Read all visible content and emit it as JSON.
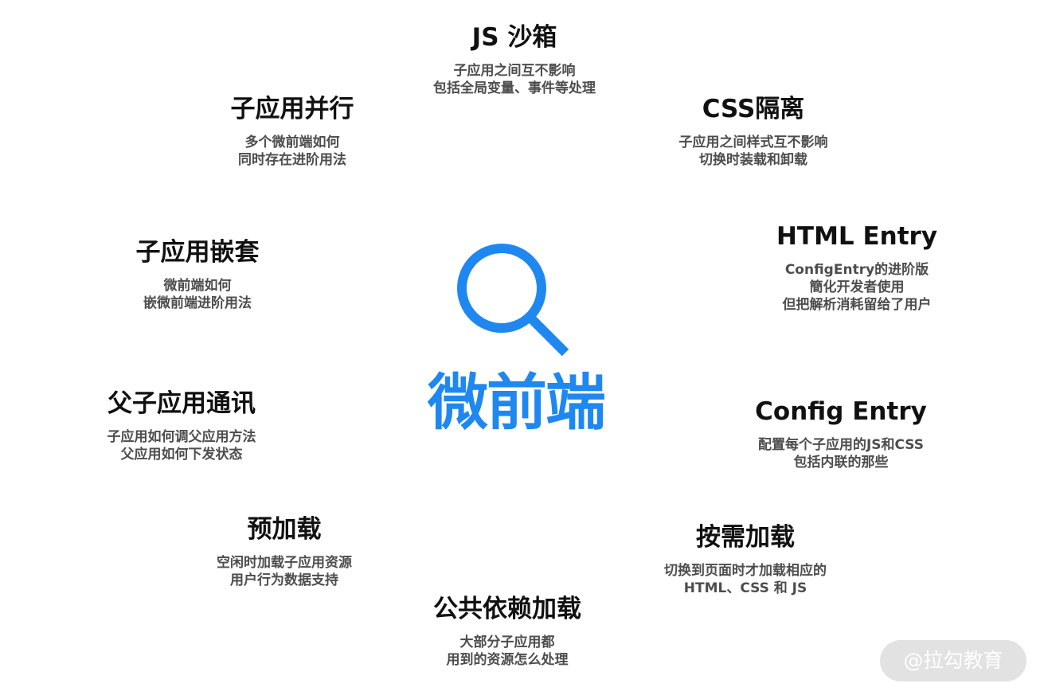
{
  "center": {
    "title": "微前端",
    "icon": "search-icon",
    "color": "#1e88f0"
  },
  "features": [
    {
      "id": "js-sandbox",
      "title": "JS 沙箱",
      "lines": [
        "子应用之间互不影响",
        "包括全局变量、事件等处理"
      ]
    },
    {
      "id": "css-isolation",
      "title": "CSS隔离",
      "lines": [
        "子应用之间样式互不影响",
        "切换时装载和卸载"
      ]
    },
    {
      "id": "html-entry",
      "title": "HTML Entry",
      "lines": [
        "ConfigEntry的进阶版",
        "簡化开发者使用",
        "但把解析消耗留给了用户"
      ]
    },
    {
      "id": "config-entry",
      "title": "Config Entry",
      "lines": [
        "配置每个子应用的JS和CSS",
        "包括内联的那些"
      ]
    },
    {
      "id": "on-demand-loading",
      "title": "按需加载",
      "lines": [
        "切换到页面时才加载相应的",
        "HTML、CSS 和 JS"
      ]
    },
    {
      "id": "shared-deps",
      "title": "公共依赖加载",
      "lines": [
        "大部分子应用都",
        "用到的资源怎么处理"
      ]
    },
    {
      "id": "preload",
      "title": "预加载",
      "lines": [
        "空闲时加载子应用资源",
        "用户行为数据支持"
      ]
    },
    {
      "id": "parent-child-comm",
      "title": "父子应用通讯",
      "lines": [
        "子应用如何调父应用方法",
        "父应用如何下发状态"
      ]
    },
    {
      "id": "nesting",
      "title": "子应用嵌套",
      "lines": [
        "微前端如何",
        "嵌微前端进阶用法"
      ]
    },
    {
      "id": "parallel",
      "title": "子应用并行",
      "lines": [
        "多个微前端如何",
        "同时存在进阶用法"
      ]
    }
  ],
  "watermark": "@拉勾教育"
}
